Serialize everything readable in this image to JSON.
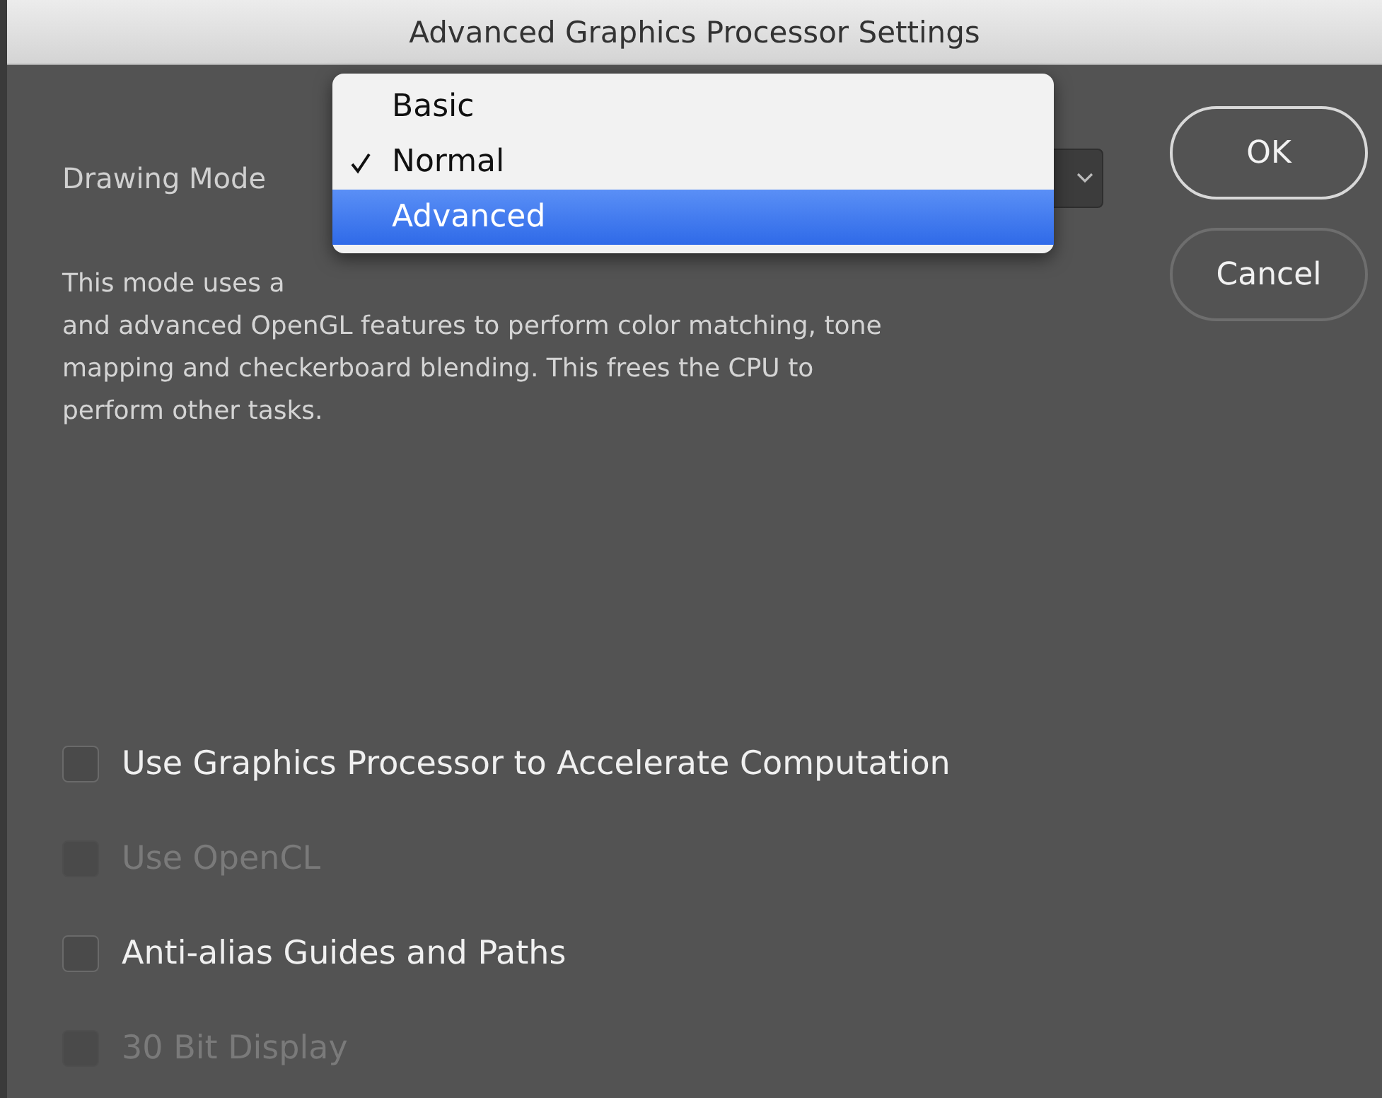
{
  "window": {
    "title": "Advanced Graphics Processor Settings"
  },
  "drawing_mode": {
    "label": "Drawing Mode",
    "menu": [
      {
        "label": "Basic",
        "selected": false,
        "highlighted": false
      },
      {
        "label": "Normal",
        "selected": true,
        "highlighted": false
      },
      {
        "label": "Advanced",
        "selected": false,
        "highlighted": true
      }
    ]
  },
  "description": [
    "This mode uses a",
    "and advanced OpenGL features to perform color matching, tone",
    "mapping and checkerboard blending.  This frees the CPU to",
    "perform other tasks."
  ],
  "buttons": [
    {
      "label": "OK",
      "default": true
    },
    {
      "label": "Cancel",
      "default": false
    }
  ],
  "options": [
    {
      "label": "Use Graphics Processor to Accelerate Computation",
      "checked": false,
      "disabled": false
    },
    {
      "label": "Use OpenCL",
      "checked": false,
      "disabled": true
    },
    {
      "label": "Anti-alias Guides and Paths",
      "checked": false,
      "disabled": false
    },
    {
      "label": "30 Bit Display",
      "checked": false,
      "disabled": true
    }
  ]
}
